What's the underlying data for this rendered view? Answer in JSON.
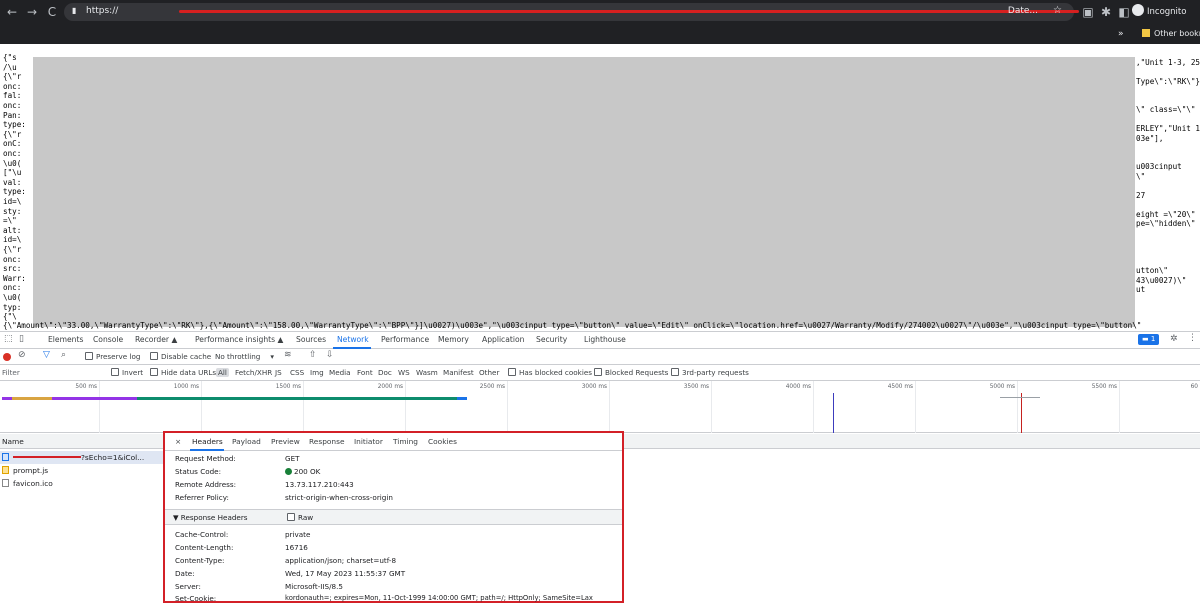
{
  "browser": {
    "url_prefix": "https://",
    "url_suffix": "Date...",
    "incognito_label": "Incognito",
    "bookmarks_overflow": "»",
    "other_bookmarks": "Other bookmarks"
  },
  "page_json": {
    "lines_left": [
      "{\"s",
      "/\\u",
      "{\\\"r",
      "onc:",
      "fal:",
      "onc:",
      "Pan:",
      "type:",
      "{\\\"r",
      "onC:",
      "onc:",
      "\\u0(",
      "[\"\\u",
      "val:",
      "type:",
      "id=\\",
      "sty:",
      "=\\\"",
      "alt:",
      "id=\\",
      "{\\\"r",
      "onc:",
      "src:",
      "Warr:",
      "onc:",
      "\\u0(",
      "typ:",
      "{\"\\"
    ],
    "lines_right": [
      ",\"Unit 1-3, 25",
      "",
      "Type\\\":\\\"RK\\\"},",
      "",
      "\\\" class=\\\"\\\"",
      "",
      "ERLEY\",\"Unit 1",
      "03e\"],",
      "",
      "u003cinput",
      "\\\"",
      "27",
      "",
      "eight =\\\"20\\\"",
      "pe=\\\"hidden\\\"",
      "",
      "",
      "",
      "",
      "utton\\\"",
      "43\\u0027)\\\"",
      "ut"
    ],
    "bottom_line": "{\\\"Amount\\\":\\\"33.00,\\\"WarrantyType\\\":\\\"RK\\\"},{\\\"Amount\\\":\\\"158.00,\\\"WarrantyType\\\":\\\"BPP\\\"}]\\u0027)\\u003e\",\"\\u003cinput type=\\\"button\\\" value=\\\"Edit\\\" onClick=\\\"location.href=\\u0027/Warranty/Modify/274002\\u0027\\\"/\\u003e\",\"\\u003cinput type=\\\"button\\\""
  },
  "devtools": {
    "tabs": [
      "Elements",
      "Console",
      "Recorder ▲",
      "Performance insights ▲",
      "Sources",
      "Network",
      "Performance",
      "Memory",
      "Application",
      "Security",
      "Lighthouse"
    ],
    "active_tab": "Network",
    "issues_badge": "1",
    "toolbar": {
      "preserve_log": "Preserve log",
      "disable_cache": "Disable cache",
      "throttling": "No throttling"
    },
    "filter": {
      "placeholder": "Filter",
      "invert": "Invert",
      "hide_data_urls": "Hide data URLs",
      "types": [
        "All",
        "Fetch/XHR",
        "JS",
        "CSS",
        "Img",
        "Media",
        "Font",
        "Doc",
        "WS",
        "Wasm",
        "Manifest",
        "Other"
      ],
      "has_blocked_cookies": "Has blocked cookies",
      "blocked_requests": "Blocked Requests",
      "third_party": "3rd-party requests"
    },
    "timeline_ticks": [
      "500 ms",
      "1000 ms",
      "1500 ms",
      "2000 ms",
      "2500 ms",
      "3000 ms",
      "3500 ms",
      "4000 ms",
      "4500 ms",
      "5000 ms",
      "5500 ms",
      "60"
    ],
    "requests": {
      "column_name": "Name",
      "rows": [
        {
          "name": "?sEcho=1&iCol...",
          "selected": true
        },
        {
          "name": "prompt.js",
          "selected": false
        },
        {
          "name": "favicon.ico",
          "selected": false
        }
      ]
    },
    "headers_panel": {
      "close": "×",
      "tabs": [
        "Headers",
        "Payload",
        "Preview",
        "Response",
        "Initiator",
        "Timing",
        "Cookies"
      ],
      "active_tab": "Headers",
      "general": [
        {
          "key": "Request Method:",
          "value": "GET"
        },
        {
          "key": "Status Code:",
          "value": "200 OK"
        },
        {
          "key": "Remote Address:",
          "value": "13.73.117.210:443"
        },
        {
          "key": "Referrer Policy:",
          "value": "strict-origin-when-cross-origin"
        }
      ],
      "response_section_title": "▼ Response Headers",
      "raw_label": "Raw",
      "response_headers": [
        {
          "key": "Cache-Control:",
          "value": "private"
        },
        {
          "key": "Content-Length:",
          "value": "16716"
        },
        {
          "key": "Content-Type:",
          "value": "application/json; charset=utf-8"
        },
        {
          "key": "Date:",
          "value": "Wed, 17 May 2023 11:55:37 GMT"
        },
        {
          "key": "Server:",
          "value": "Microsoft-IIS/8.5"
        },
        {
          "key": "Set-Cookie:",
          "value": "kordonauth=; expires=Mon, 11-Oct-1999 14:00:00 GMT; path=/; HttpOnly; SameSite=Lax"
        }
      ]
    }
  },
  "colors": {
    "highlight_border": "#d32027",
    "status_ok": "#188038",
    "accent": "#1a73e8"
  }
}
